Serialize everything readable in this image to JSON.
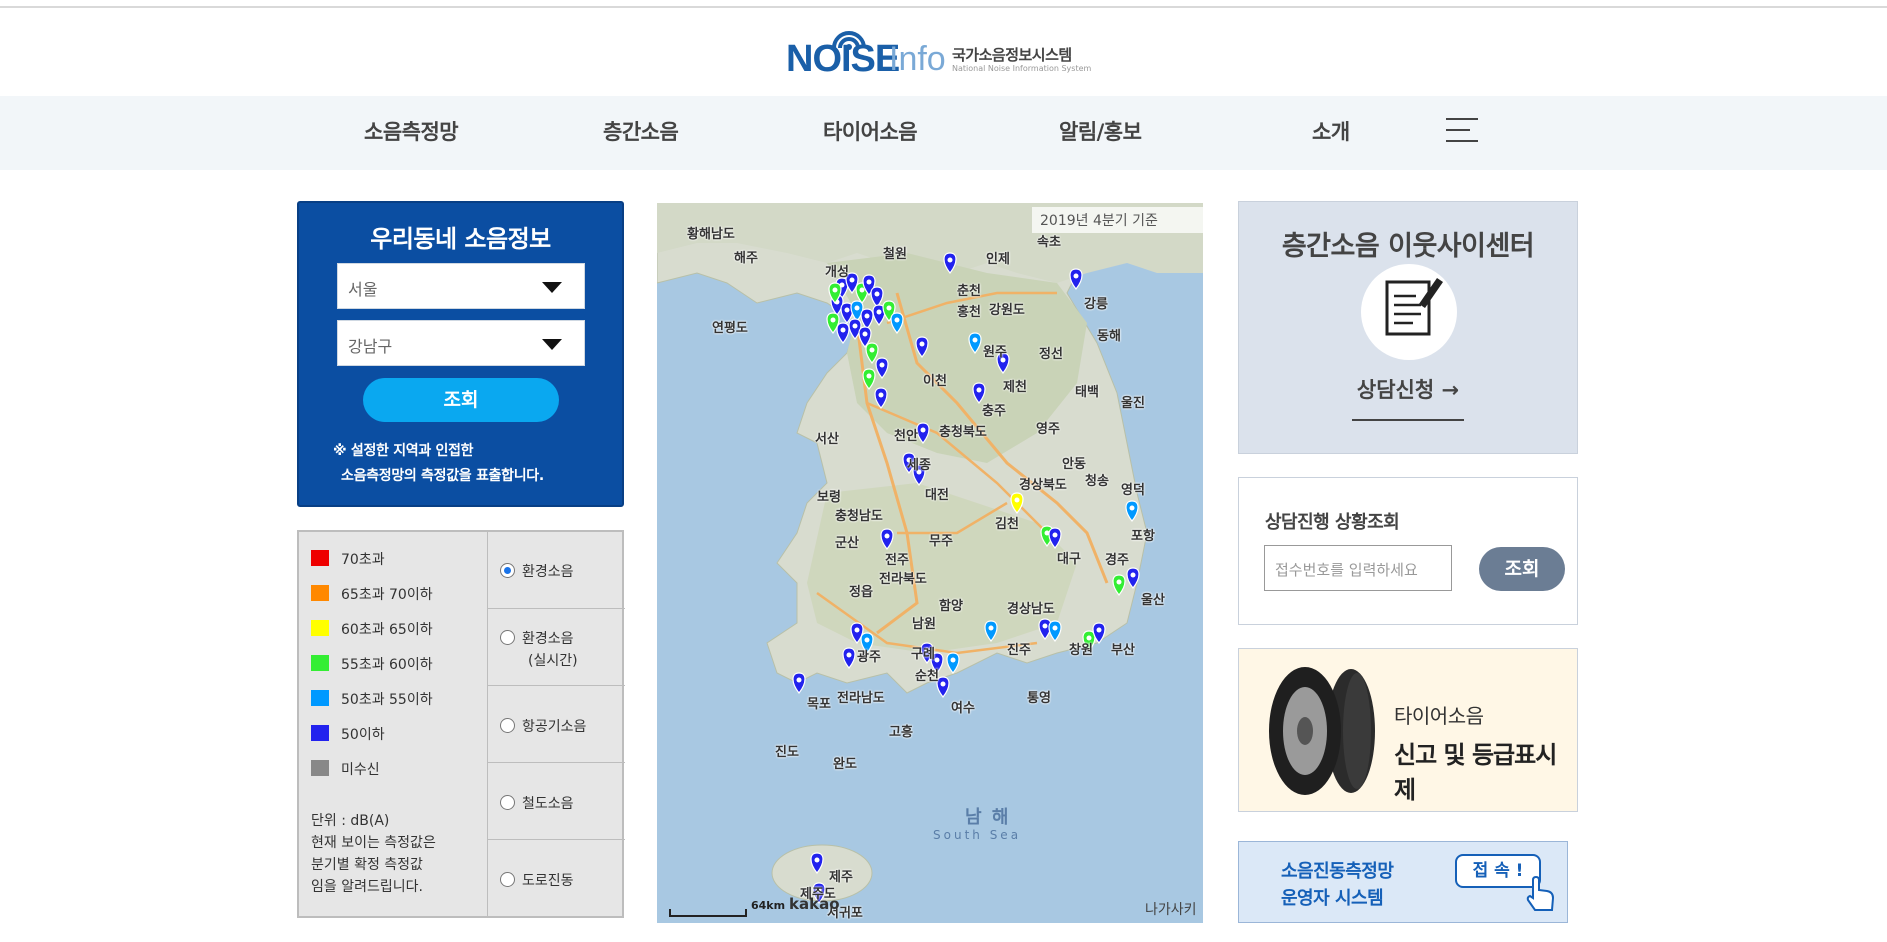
{
  "logo": {
    "noise": "NOISE",
    "info": "Info",
    "title_kr": "국가소음정보시스템",
    "title_en": "National Noise Information System"
  },
  "nav": {
    "items": [
      "소음측정망",
      "층간소음",
      "타이어소음",
      "알림/홍보",
      "소개"
    ]
  },
  "local": {
    "title": "우리동네 소음정보",
    "city": "서울",
    "district": "강남구",
    "search_label": "조회",
    "note_line1": "※ 설정한 지역과 인접한",
    "note_line2": "소음측정망의 측정값을 표출합니다."
  },
  "legend": {
    "items": [
      {
        "label": "70초과",
        "color": "#ee0000"
      },
      {
        "label": "65초과 70이하",
        "color": "#ff8800"
      },
      {
        "label": "60초과 65이하",
        "color": "#ffff00"
      },
      {
        "label": "55초과 60이하",
        "color": "#33ee33"
      },
      {
        "label": "50초과 55이하",
        "color": "#0099ff"
      },
      {
        "label": "50이하",
        "color": "#2222ee"
      },
      {
        "label": "미수신",
        "color": "#888888"
      }
    ],
    "unit": "단위 : dB(A)",
    "note1": "현재 보이는 측정값은",
    "note2": "분기별 확정 측정값",
    "note3": "임을 알려드립니다.",
    "options": [
      {
        "label": "환경소음",
        "label2": "",
        "selected": true
      },
      {
        "label": "환경소음",
        "label2": "(실시간)",
        "selected": false
      },
      {
        "label": "항공기소음",
        "label2": "",
        "selected": false
      },
      {
        "label": "철도소음",
        "label2": "",
        "selected": false
      },
      {
        "label": "도로진동",
        "label2": "",
        "selected": false
      }
    ]
  },
  "map": {
    "date_label": "2019년 4분기 기준",
    "cities": [
      "황해남도",
      "해주",
      "개성",
      "철원",
      "인제",
      "속초",
      "춘천",
      "홍천",
      "강원도",
      "연평도",
      "원주",
      "정선",
      "강릉",
      "동해",
      "이천",
      "제천",
      "태백",
      "충주",
      "울진",
      "서산",
      "천안",
      "충청북도",
      "영주",
      "세종",
      "안동",
      "대전",
      "보령",
      "경상북도",
      "청송",
      "영덕",
      "충청남도",
      "김천",
      "포항",
      "군산",
      "무주",
      "대구",
      "전주",
      "경주",
      "전라북도",
      "정읍",
      "함양",
      "경상남도",
      "울산",
      "남원",
      "광주",
      "구례",
      "진주",
      "창원",
      "부산",
      "전라남도",
      "목포",
      "순천",
      "여수",
      "통영",
      "고흥",
      "진도",
      "완도",
      "제주",
      "제주도",
      "서귀포"
    ],
    "sea": "남 해",
    "sea_en": "South Sea",
    "scale": "64km",
    "brand": "kakao",
    "copyright": "나가사키"
  },
  "center": {
    "title": "층간소음 이웃사이센터",
    "consult_label": "상담신청 →"
  },
  "status": {
    "title": "상담진행 상황조회",
    "placeholder": "접수번호를 입력하세요",
    "search_label": "조회"
  },
  "tire": {
    "line1": "타이어소음",
    "line2": "신고 및 등급표시제"
  },
  "noise_system": {
    "line1": "소음진동측정망",
    "line2": "운영자 시스템",
    "connect_label": "접 속 !"
  }
}
